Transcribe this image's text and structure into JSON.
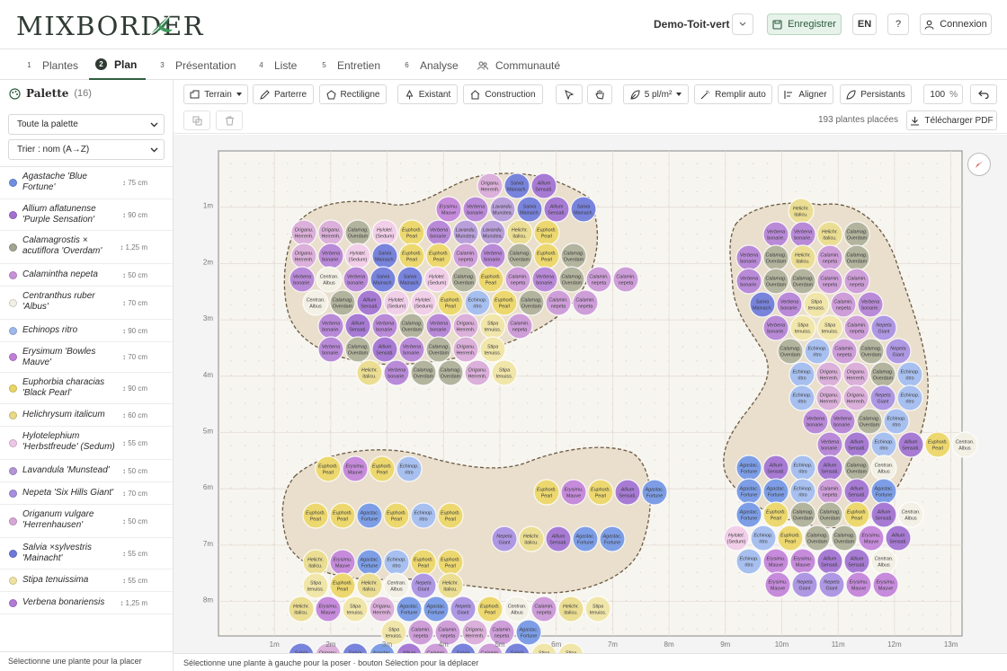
{
  "app": {
    "logo": "MIXBORDER",
    "project_name": "Demo-Toit-vert"
  },
  "header": {
    "save_label": "Enregistrer",
    "lang_label": "EN",
    "help_label": "?",
    "login_label": "Connexion"
  },
  "tabs": [
    {
      "num": "1",
      "label": "Plantes"
    },
    {
      "num": "2",
      "label": "Plan"
    },
    {
      "num": "3",
      "label": "Présentation"
    },
    {
      "num": "4",
      "label": "Liste"
    },
    {
      "num": "5",
      "label": "Entretien"
    },
    {
      "num": "6",
      "label": "Analyse"
    },
    {
      "num": "",
      "label": "Communauté"
    }
  ],
  "sidebar": {
    "title": "Palette",
    "count": "(16)",
    "filter_value": "Toute la palette",
    "sort_value": "Trier : nom (A→Z)",
    "status": "Sélectionne une plante pour la placer",
    "plants": [
      {
        "name": "Agastache 'Blue Fortune'",
        "height": "↕ 75 cm",
        "color": "#6f8fe0"
      },
      {
        "name": "Allium aflatunense 'Purple Sensation'",
        "height": "↕ 90 cm",
        "color": "#a46fd0"
      },
      {
        "name": "Calamagrostis × acutiflora 'Overdam'",
        "height": "↕ 1,25 m",
        "color": "#a3a492"
      },
      {
        "name": "Calamintha nepeta",
        "height": "↕ 50 cm",
        "color": "#c991d6"
      },
      {
        "name": "Centranthus ruber 'Albus'",
        "height": "↕ 70 cm",
        "color": "#f2f0e4"
      },
      {
        "name": "Echinops ritro",
        "height": "↕ 90 cm",
        "color": "#9fb8ec"
      },
      {
        "name": "Erysimum 'Bowles Mauve'",
        "height": "↕ 70 cm",
        "color": "#c07fd8"
      },
      {
        "name": "Euphorbia characias 'Black Pearl'",
        "height": "↕ 90 cm",
        "color": "#e9d466"
      },
      {
        "name": "Helichrysum italicum",
        "height": "↕ 60 cm",
        "color": "#e7d985"
      },
      {
        "name": "Hylotelephium 'Herbstfreude' (Sedum)",
        "height": "↕ 55 cm",
        "color": "#f0c6e6"
      },
      {
        "name": "Lavandula 'Munstead'",
        "height": "↕ 50 cm",
        "color": "#b296d6"
      },
      {
        "name": "Nepeta 'Six Hills Giant'",
        "height": "↕ 70 cm",
        "color": "#a68fe0"
      },
      {
        "name": "Origanum vulgare 'Herrenhausen'",
        "height": "↕ 50 cm",
        "color": "#d7a6d6"
      },
      {
        "name": "Salvia ×sylvestris 'Mainacht'",
        "height": "↕ 55 cm",
        "color": "#6f79d8"
      },
      {
        "name": "Stipa tenuissima",
        "height": "↕ 55 cm",
        "color": "#efe2a0"
      },
      {
        "name": "Verbena bonariensis",
        "height": "↕ 1,25 m",
        "color": "#b27bd6"
      }
    ]
  },
  "toolbar": {
    "terrain_label": "Terrain",
    "parterre_label": "Parterre",
    "rect_label": "Rectiligne",
    "existant_label": "Existant",
    "construction_label": "Construction",
    "density_label": "5 pl/m²",
    "fill_label": "Remplir auto",
    "align_label": "Aligner",
    "persist_label": "Persistants",
    "zoom_value": "100",
    "zoom_unit": "%",
    "count_label": "193 plantes placées",
    "pdf_label": "Télécharger PDF"
  },
  "axes": {
    "x_labels": [
      "1m",
      "2m",
      "3m",
      "4m",
      "5m",
      "6m",
      "7m",
      "8m",
      "9m",
      "10m",
      "11m",
      "12m",
      "13m"
    ],
    "y_labels": [
      "1m",
      "2m",
      "3m",
      "4m",
      "5m",
      "6m",
      "7m",
      "8m"
    ]
  },
  "plant_codes": {
    "A": {
      "l1": "Agastac.",
      "l2": "Fortune",
      "fill": "#7d9ee6"
    },
    "L": {
      "l1": "Allium",
      "l2": "Sensati.",
      "fill": "#a77bd4"
    },
    "C": {
      "l1": "Calamag.",
      "l2": "Overdam",
      "fill": "#b3b49e"
    },
    "N": {
      "l1": "Calamin.",
      "l2": "nepeta",
      "fill": "#ce9ed9"
    },
    "R": {
      "l1": "Centran.",
      "l2": "Albus",
      "fill": "#f3f1e6"
    },
    "E": {
      "l1": "Echinop.",
      "l2": "ritro",
      "fill": "#a8c0ef"
    },
    "Y": {
      "l1": "Erysimu.",
      "l2": "Mauve",
      "fill": "#c68bdb"
    },
    "P": {
      "l1": "Euphorb.",
      "l2": "Pearl",
      "fill": "#ecd86f"
    },
    "H": {
      "l1": "Helichr.",
      "l2": "italicu.",
      "fill": "#ebde93"
    },
    "S": {
      "l1": "Hylotel.",
      "l2": "(Sedum)",
      "fill": "#f2cfe9"
    },
    "M": {
      "l1": "Lavandu.",
      "l2": "Munstea.",
      "fill": "#b9a0da"
    },
    "G": {
      "l1": "Nepeta",
      "l2": "Giant",
      "fill": "#ae98e3"
    },
    "O": {
      "l1": "Origanu.",
      "l2": "Herrenh.",
      "fill": "#dbb0da"
    },
    "V": {
      "l1": "Salvia",
      "l2": "Mainach.",
      "fill": "#7883dc"
    },
    "T": {
      "l1": "Stipa",
      "l2": "tenuiss.",
      "fill": "#f1e6aa"
    },
    "B": {
      "l1": "Verbena",
      "l2": "bonarie.",
      "fill": "#b98ad8"
    }
  },
  "bed1_rows": [
    "OVL",
    "YBMVLV",
    "OOCSPBMMHP",
    "OBSVPPNBCPC",
    "BRBVVSCPNBCNN",
    "RCLSSPEPCNN",
    "BLBCBOTN",
    "BCLBCOT",
    "HBCCOT"
  ],
  "bed2_rows": [
    "H",
    "BBHC",
    "BCHNC",
    "BCCNN",
    "VBTNB",
    "BTTNG",
    "CENCG",
    "EOOCE",
    "EOOGE",
    "BBCE",
    "BLELPR",
    "ALELCR",
    "AAENLA",
    "APCCPLR",
    "SEPCCYL",
    "EYYLLR",
    "YGGYY"
  ],
  "bed3_rows": [
    "PYPE",
    "PYPLA",
    "PPAPEP",
    "GHLAA",
    "HYAEPP",
    "TPHRGH",
    "HYTOAAGPRNHT",
    "TNNONA",
    "VOVALNVNVTT"
  ]
}
